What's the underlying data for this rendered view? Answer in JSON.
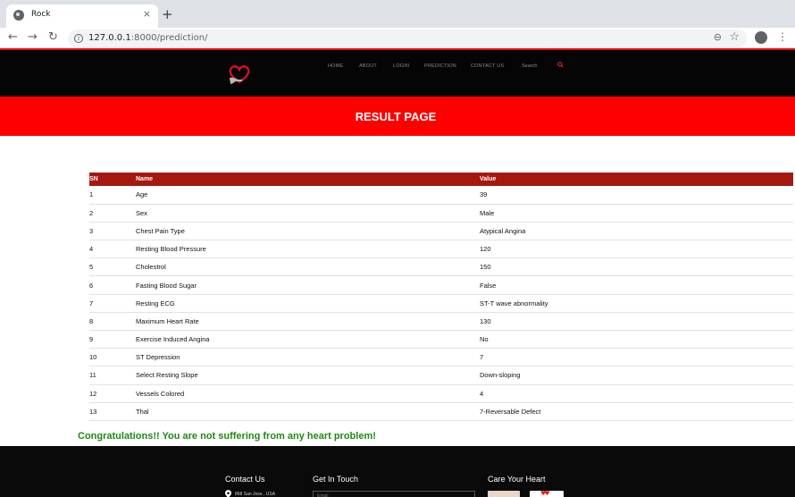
{
  "browser": {
    "tab_title": "Rock",
    "tab_close": "×",
    "new_tab": "+",
    "url_host": "127.0.0.1",
    "url_path": ":8000/prediction/",
    "back": "←",
    "forward": "→",
    "reload": "↻",
    "zoom": "⊖",
    "bookmark": "☆",
    "menu": "⋮"
  },
  "nav": {
    "items": [
      "HOME",
      "ABOUT",
      "LOGIN",
      "PREDICTION",
      "CONTACT US"
    ],
    "search_label": "Search"
  },
  "banner": {
    "title": "RESULT PAGE"
  },
  "table": {
    "headers": {
      "sn": "SN",
      "name": "Name",
      "value": "Value"
    },
    "rows": [
      {
        "sn": "1",
        "name": "Age",
        "value": "39"
      },
      {
        "sn": "2",
        "name": "Sex",
        "value": "Male"
      },
      {
        "sn": "3",
        "name": "Chest Pain Type",
        "value": "Atypical Angina"
      },
      {
        "sn": "4",
        "name": "Resting Blood Pressure",
        "value": "120"
      },
      {
        "sn": "5",
        "name": "Cholestrol",
        "value": "150"
      },
      {
        "sn": "6",
        "name": "Fasting Blood Sugar",
        "value": "False"
      },
      {
        "sn": "7",
        "name": "Resting ECG",
        "value": "ST-T wave abnormality"
      },
      {
        "sn": "8",
        "name": "Maximum Heart Rate",
        "value": "130"
      },
      {
        "sn": "9",
        "name": "Exercise Induced Angina",
        "value": "No"
      },
      {
        "sn": "10",
        "name": "ST Depression",
        "value": "7"
      },
      {
        "sn": "11",
        "name": "Select Resting Slope",
        "value": "Down-sloping"
      },
      {
        "sn": "12",
        "name": "Vessels Colored",
        "value": "4"
      },
      {
        "sn": "13",
        "name": "Thal",
        "value": "7-Reversable Defect"
      }
    ]
  },
  "result": {
    "message": "Congratulations!! You are not suffering from any heart problem!"
  },
  "footer": {
    "contact_heading": "Contact Us",
    "touch_heading": "Get In Touch",
    "care_heading": "Care Your Heart",
    "address": "868 San Jose , USA",
    "email_placeholder": "Email"
  },
  "colors": {
    "brand_red": "#ff0000",
    "table_header": "#a51810",
    "success_green": "#1d8a10"
  }
}
